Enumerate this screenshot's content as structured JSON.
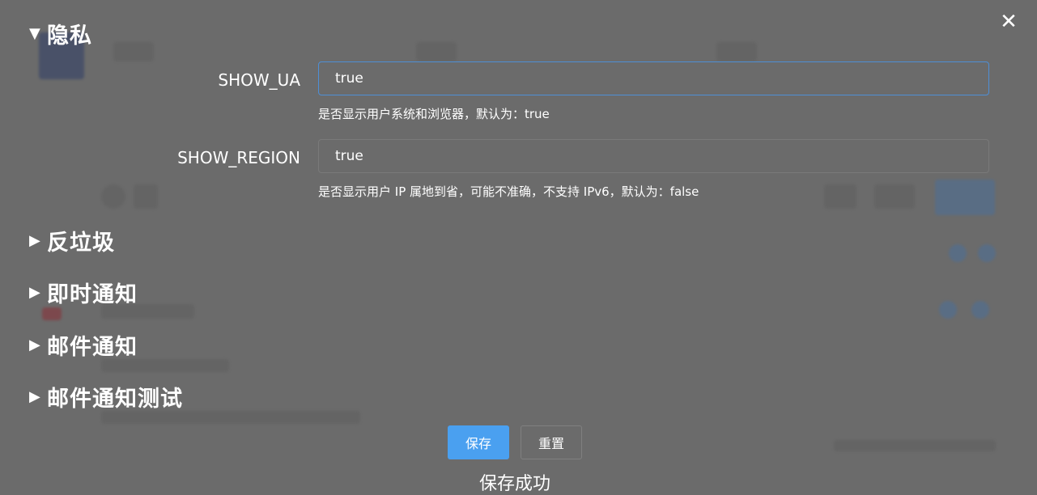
{
  "window": {
    "close_icon": "close-icon",
    "close_glyph": "✕"
  },
  "sections": [
    {
      "title": "隐私",
      "expanded": true,
      "arrow": "▼"
    },
    {
      "title": "反垃圾",
      "expanded": false,
      "arrow": "▶"
    },
    {
      "title": "即时通知",
      "expanded": false,
      "arrow": "▶"
    },
    {
      "title": "邮件通知",
      "expanded": false,
      "arrow": "▶"
    },
    {
      "title": "邮件通知测试",
      "expanded": false,
      "arrow": "▶"
    }
  ],
  "privacy": {
    "show_ua": {
      "label": "SHOW_UA",
      "value": "true",
      "hint": "是否显示用户系统和浏览器，默认为：true"
    },
    "show_region": {
      "label": "SHOW_REGION",
      "value": "true",
      "hint": "是否显示用户 IP 属地到省，可能不准确，不支持 IPv6，默认为：false"
    }
  },
  "actions": {
    "save_label": "保存",
    "reset_label": "重置"
  },
  "status": {
    "message": "保存成功"
  },
  "colors": {
    "overlay": "#6b6b6b",
    "primary": "#4aa0f0",
    "focus_border": "#4e8fd6"
  }
}
